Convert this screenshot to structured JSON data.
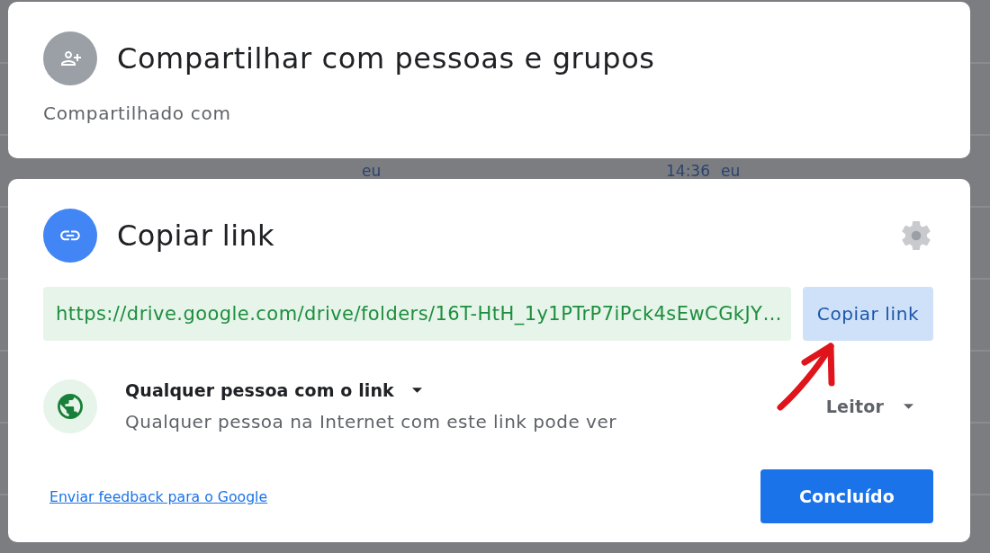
{
  "share_people": {
    "title": "Compartilhar com pessoas e grupos",
    "subtitle": "Compartilhado com"
  },
  "background_row": {
    "column_1": "eu",
    "column_2": "14:36",
    "column_3": "eu"
  },
  "copy_link": {
    "title": "Copiar link",
    "url": "https://drive.google.com/drive/folders/16T-HtH_1y1PTrP7iPck4sEwCGkJY…",
    "copy_button": "Copiar link",
    "access": {
      "scope": "Qualquer pessoa com o link",
      "description": "Qualquer pessoa na Internet com este link pode ver",
      "role": "Leitor"
    },
    "feedback_link": "Enviar feedback para o Google",
    "done_button": "Concluído"
  }
}
